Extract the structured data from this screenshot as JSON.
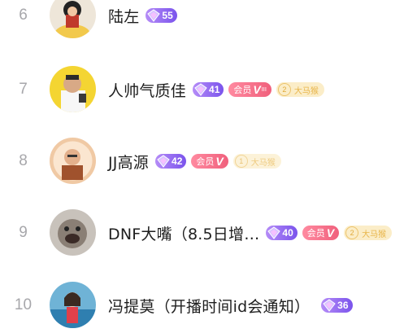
{
  "rows": [
    {
      "rank": "6",
      "name": "陆左",
      "level": "55"
    },
    {
      "rank": "7",
      "name": "人帅气质佳",
      "level": "41",
      "vip": "会员",
      "vip_sub": "III",
      "fan_level": "2",
      "fan_name": "大马猴"
    },
    {
      "rank": "8",
      "name": "JJ高源",
      "level": "42",
      "vip": "会员",
      "fan_level": "1",
      "fan_name": "大马猴"
    },
    {
      "rank": "9",
      "name": "DNF大嘴（8.5日增…",
      "level": "40",
      "vip": "会员",
      "fan_level": "2",
      "fan_name": "大马猴"
    },
    {
      "rank": "10",
      "name": "冯提莫（开播时间id会通知）",
      "level": "36"
    }
  ],
  "colors": {
    "level_badge": "#8a5ff0",
    "vip_badge": "#f36f88",
    "fan_badge": "#fbedc8",
    "rank_text": "#a7a7ab"
  },
  "icons": {
    "level": "purple-gem-icon",
    "vip": "v-check-icon"
  }
}
